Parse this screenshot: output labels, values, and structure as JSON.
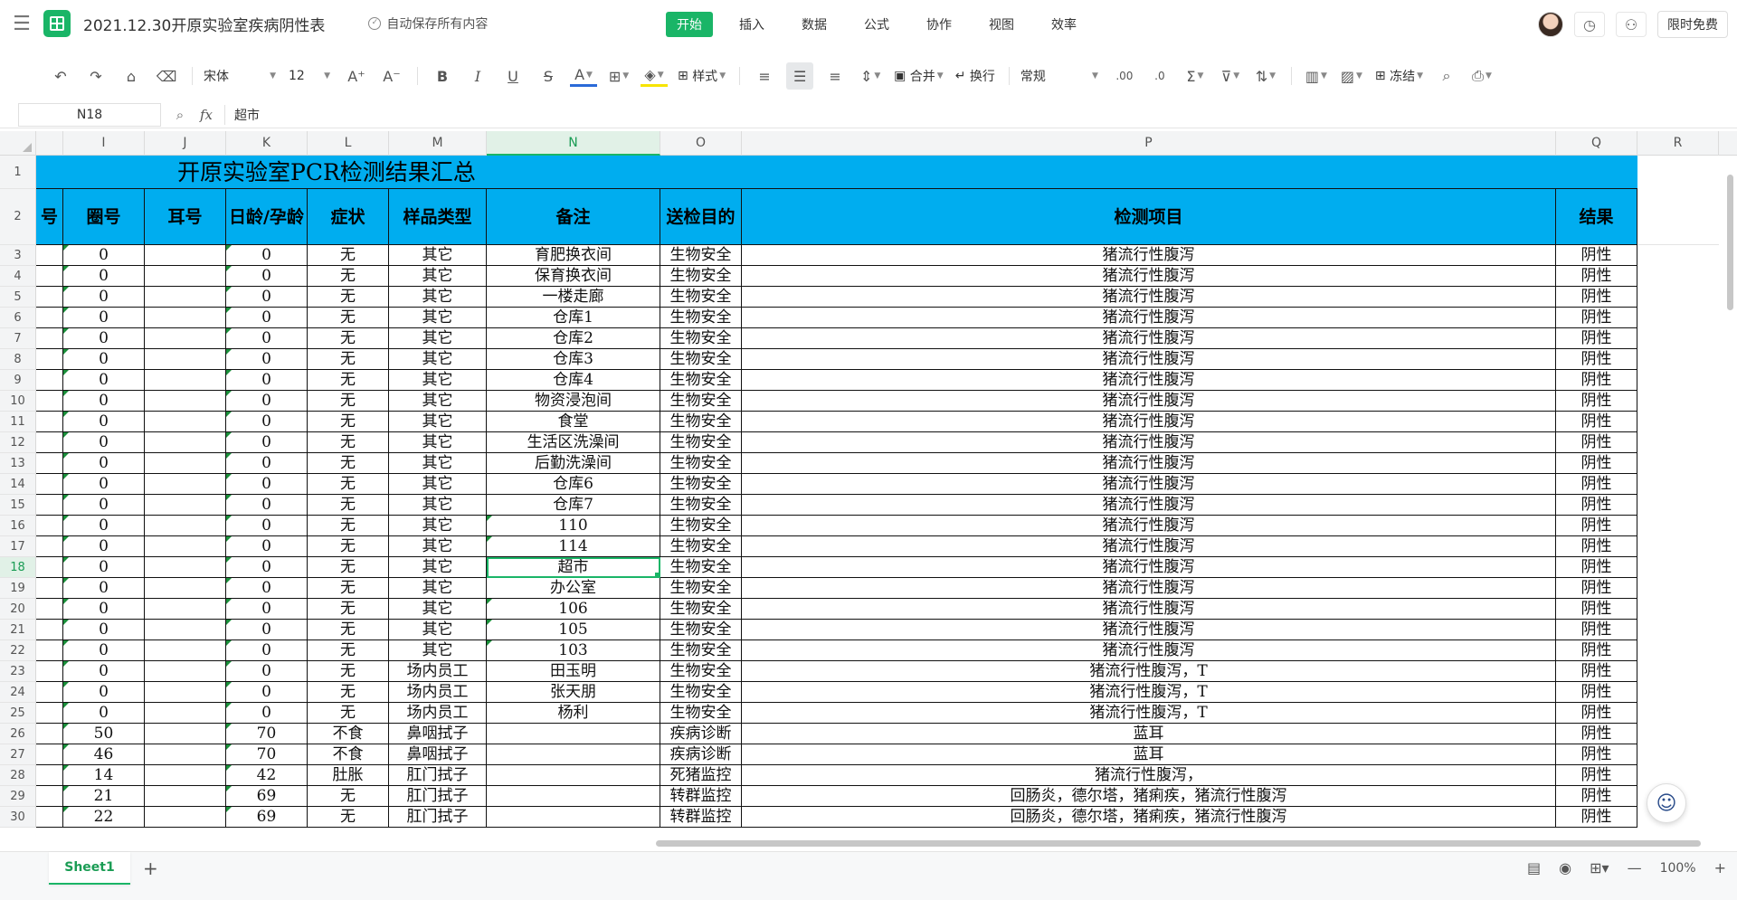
{
  "app": {
    "title": "2021.12.30开原实验室疾病阴性表",
    "autosave": "自动保存所有内容",
    "tabs": [
      "开始",
      "插入",
      "数据",
      "公式",
      "协作",
      "视图",
      "效率"
    ],
    "active_tab": "开始",
    "limited_free": "限时免费",
    "accent_color": "#1ab567"
  },
  "toolbar": {
    "font_name": "宋体",
    "font_size": "12",
    "style_label": "样式",
    "merge_label": "合并",
    "wrap_label": "换行",
    "number_format": "常规",
    "freeze_label": "冻结",
    "icons": [
      "undo-icon",
      "redo-icon",
      "format-painter-icon",
      "clear-format-icon",
      "increase-font-icon",
      "decrease-font-icon",
      "bold-icon",
      "italic-icon",
      "underline-icon",
      "strikethrough-icon",
      "font-color-icon",
      "border-icon",
      "fill-color-icon",
      "table-style-icon",
      "align-left-icon",
      "align-center-icon",
      "align-right-icon",
      "vertical-align-icon",
      "merge-icon",
      "wrap-icon",
      "decimal-increase-icon",
      "decimal-decrease-icon",
      "sum-icon",
      "filter-icon",
      "sort-icon",
      "chart-icon",
      "image-icon",
      "freeze-icon",
      "search-icon",
      "print-icon"
    ]
  },
  "formula_bar": {
    "cell_ref": "N18",
    "content": "超市"
  },
  "columns": [
    "I",
    "J",
    "K",
    "L",
    "M",
    "N",
    "O",
    "P",
    "Q",
    "R"
  ],
  "selected_column": "N",
  "selected_row": "18",
  "sheet": {
    "title": "开原实验室PCR检测结果汇总",
    "header_fill": "#00adef",
    "partial_header": "号",
    "headers": [
      "圈号",
      "耳号",
      "日龄/孕龄",
      "症状",
      "样品类型",
      "备注",
      "送检目的",
      "检测项目",
      "结果"
    ],
    "rows": [
      {
        "row": "3",
        "pen": "0",
        "ear": "",
        "age": "0",
        "symptom": "无",
        "sample": "其它",
        "note": "育肥换衣间",
        "purpose": "生物安全",
        "item": "猪流行性腹泻",
        "result": "阴性"
      },
      {
        "row": "4",
        "pen": "0",
        "ear": "",
        "age": "0",
        "symptom": "无",
        "sample": "其它",
        "note": "保育换衣间",
        "purpose": "生物安全",
        "item": "猪流行性腹泻",
        "result": "阴性"
      },
      {
        "row": "5",
        "pen": "0",
        "ear": "",
        "age": "0",
        "symptom": "无",
        "sample": "其它",
        "note": "一楼走廊",
        "purpose": "生物安全",
        "item": "猪流行性腹泻",
        "result": "阴性"
      },
      {
        "row": "6",
        "pen": "0",
        "ear": "",
        "age": "0",
        "symptom": "无",
        "sample": "其它",
        "note": "仓库1",
        "purpose": "生物安全",
        "item": "猪流行性腹泻",
        "result": "阴性"
      },
      {
        "row": "7",
        "pen": "0",
        "ear": "",
        "age": "0",
        "symptom": "无",
        "sample": "其它",
        "note": "仓库2",
        "purpose": "生物安全",
        "item": "猪流行性腹泻",
        "result": "阴性"
      },
      {
        "row": "8",
        "pen": "0",
        "ear": "",
        "age": "0",
        "symptom": "无",
        "sample": "其它",
        "note": "仓库3",
        "purpose": "生物安全",
        "item": "猪流行性腹泻",
        "result": "阴性"
      },
      {
        "row": "9",
        "pen": "0",
        "ear": "",
        "age": "0",
        "symptom": "无",
        "sample": "其它",
        "note": "仓库4",
        "purpose": "生物安全",
        "item": "猪流行性腹泻",
        "result": "阴性"
      },
      {
        "row": "10",
        "pen": "0",
        "ear": "",
        "age": "0",
        "symptom": "无",
        "sample": "其它",
        "note": "物资浸泡间",
        "purpose": "生物安全",
        "item": "猪流行性腹泻",
        "result": "阴性"
      },
      {
        "row": "11",
        "pen": "0",
        "ear": "",
        "age": "0",
        "symptom": "无",
        "sample": "其它",
        "note": "食堂",
        "purpose": "生物安全",
        "item": "猪流行性腹泻",
        "result": "阴性"
      },
      {
        "row": "12",
        "pen": "0",
        "ear": "",
        "age": "0",
        "symptom": "无",
        "sample": "其它",
        "note": "生活区洗澡间",
        "purpose": "生物安全",
        "item": "猪流行性腹泻",
        "result": "阴性"
      },
      {
        "row": "13",
        "pen": "0",
        "ear": "",
        "age": "0",
        "symptom": "无",
        "sample": "其它",
        "note": "后勤洗澡间",
        "purpose": "生物安全",
        "item": "猪流行性腹泻",
        "result": "阴性"
      },
      {
        "row": "14",
        "pen": "0",
        "ear": "",
        "age": "0",
        "symptom": "无",
        "sample": "其它",
        "note": "仓库6",
        "purpose": "生物安全",
        "item": "猪流行性腹泻",
        "result": "阴性"
      },
      {
        "row": "15",
        "pen": "0",
        "ear": "",
        "age": "0",
        "symptom": "无",
        "sample": "其它",
        "note": "仓库7",
        "purpose": "生物安全",
        "item": "猪流行性腹泻",
        "result": "阴性"
      },
      {
        "row": "16",
        "pen": "0",
        "ear": "",
        "age": "0",
        "symptom": "无",
        "sample": "其它",
        "note": "110",
        "purpose": "生物安全",
        "item": "猪流行性腹泻",
        "result": "阴性"
      },
      {
        "row": "17",
        "pen": "0",
        "ear": "",
        "age": "0",
        "symptom": "无",
        "sample": "其它",
        "note": "114",
        "purpose": "生物安全",
        "item": "猪流行性腹泻",
        "result": "阴性"
      },
      {
        "row": "18",
        "pen": "0",
        "ear": "",
        "age": "0",
        "symptom": "无",
        "sample": "其它",
        "note": "超市",
        "purpose": "生物安全",
        "item": "猪流行性腹泻",
        "result": "阴性"
      },
      {
        "row": "19",
        "pen": "0",
        "ear": "",
        "age": "0",
        "symptom": "无",
        "sample": "其它",
        "note": "办公室",
        "purpose": "生物安全",
        "item": "猪流行性腹泻",
        "result": "阴性"
      },
      {
        "row": "20",
        "pen": "0",
        "ear": "",
        "age": "0",
        "symptom": "无",
        "sample": "其它",
        "note": "106",
        "purpose": "生物安全",
        "item": "猪流行性腹泻",
        "result": "阴性"
      },
      {
        "row": "21",
        "pen": "0",
        "ear": "",
        "age": "0",
        "symptom": "无",
        "sample": "其它",
        "note": "105",
        "purpose": "生物安全",
        "item": "猪流行性腹泻",
        "result": "阴性"
      },
      {
        "row": "22",
        "pen": "0",
        "ear": "",
        "age": "0",
        "symptom": "无",
        "sample": "其它",
        "note": "103",
        "purpose": "生物安全",
        "item": "猪流行性腹泻",
        "result": "阴性"
      },
      {
        "row": "23",
        "pen": "0",
        "ear": "",
        "age": "0",
        "symptom": "无",
        "sample": "场内员工",
        "note": "田玉明",
        "purpose": "生物安全",
        "item": "猪流行性腹泻，T",
        "result": "阴性"
      },
      {
        "row": "24",
        "pen": "0",
        "ear": "",
        "age": "0",
        "symptom": "无",
        "sample": "场内员工",
        "note": "张天朋",
        "purpose": "生物安全",
        "item": "猪流行性腹泻，T",
        "result": "阴性"
      },
      {
        "row": "25",
        "pen": "0",
        "ear": "",
        "age": "0",
        "symptom": "无",
        "sample": "场内员工",
        "note": "杨利",
        "purpose": "生物安全",
        "item": "猪流行性腹泻，T",
        "result": "阴性"
      },
      {
        "row": "26",
        "pen": "50",
        "ear": "",
        "age": "70",
        "symptom": "不食",
        "sample": "鼻咽拭子",
        "note": "",
        "purpose": "疾病诊断",
        "item": "蓝耳",
        "result": "阴性"
      },
      {
        "row": "27",
        "pen": "46",
        "ear": "",
        "age": "70",
        "symptom": "不食",
        "sample": "鼻咽拭子",
        "note": "",
        "purpose": "疾病诊断",
        "item": "蓝耳",
        "result": "阴性"
      },
      {
        "row": "28",
        "pen": "14",
        "ear": "",
        "age": "42",
        "symptom": "肚胀",
        "sample": "肛门拭子",
        "note": "",
        "purpose": "死猪监控",
        "item": "猪流行性腹泻，",
        "result": "阴性"
      },
      {
        "row": "29",
        "pen": "21",
        "ear": "",
        "age": "69",
        "symptom": "无",
        "sample": "肛门拭子",
        "note": "",
        "purpose": "转群监控",
        "item": "回肠炎，德尔塔，猪痢疾，猪流行性腹泻",
        "result": "阴性"
      },
      {
        "row": "30",
        "pen": "22",
        "ear": "",
        "age": "69",
        "symptom": "无",
        "sample": "肛门拭子",
        "note": "",
        "purpose": "转群监控",
        "item": "回肠炎，德尔塔，猪痢疾，猪流行性腹泻",
        "result": "阴性"
      }
    ]
  },
  "statusbar": {
    "sheet_name": "Sheet1",
    "zoom": "100%"
  }
}
